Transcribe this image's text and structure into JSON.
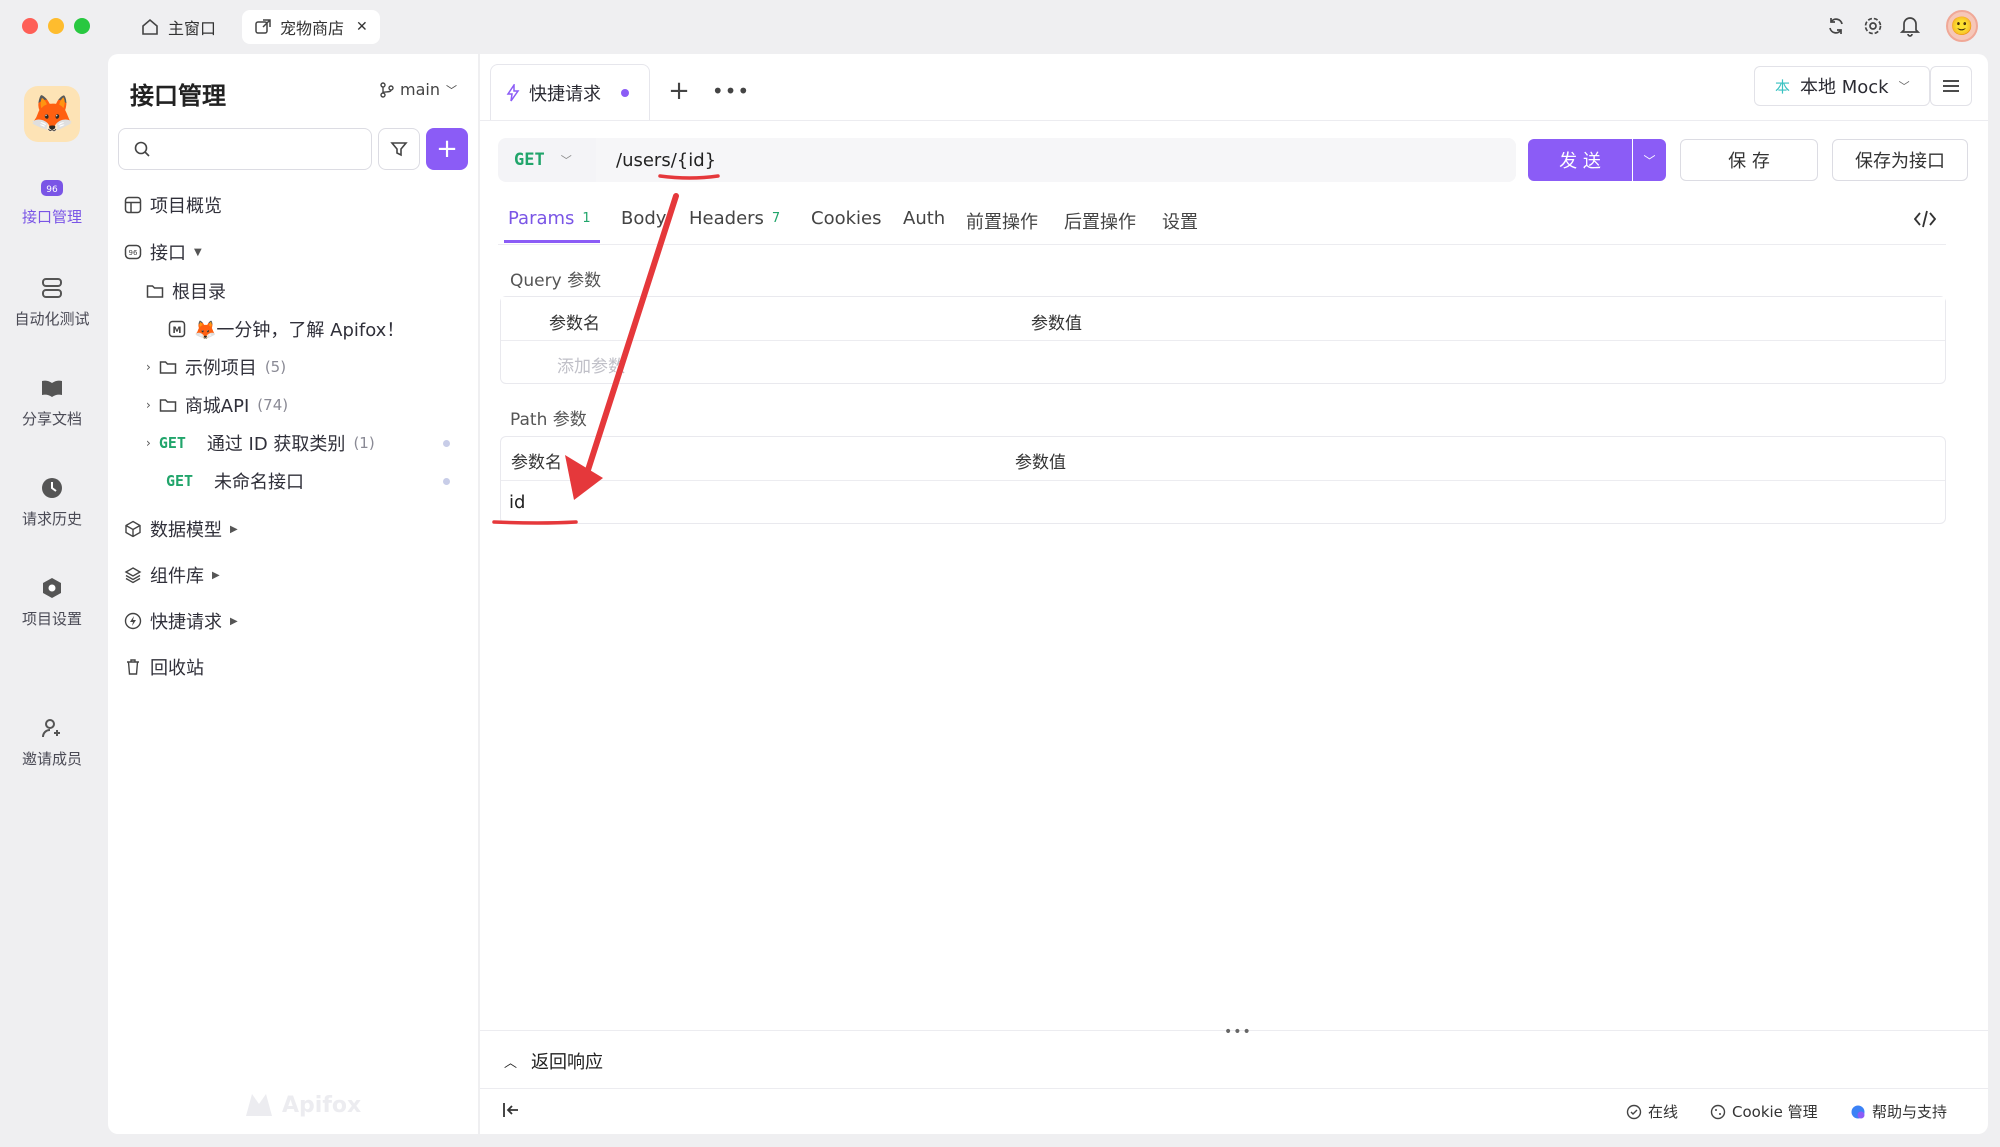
{
  "titlebar": {
    "home_tab": "主窗口",
    "project_tab": "宠物商店",
    "close": "✕"
  },
  "nav": {
    "items": [
      {
        "label": "接口管理"
      },
      {
        "label": "自动化测试"
      },
      {
        "label": "分享文档"
      },
      {
        "label": "请求历史"
      },
      {
        "label": "项目设置"
      },
      {
        "label": "邀请成员"
      }
    ]
  },
  "sidebar": {
    "title": "接口管理",
    "branch": "main",
    "search_placeholder": "",
    "overview": "项目概览",
    "api": "接口",
    "root": "根目录",
    "intro": "🦊一分钟，了解 Apifox！",
    "folder1": "示例项目",
    "folder1_count": "(5)",
    "folder2": "商城API",
    "folder2_count": "(74)",
    "get1_method": "GET",
    "get1_name": "通过 ID 获取类别",
    "get1_count": "(1)",
    "get2_method": "GET",
    "get2_name": "未命名接口",
    "models": "数据模型",
    "components": "组件库",
    "quick": "快捷请求",
    "trash": "回收站",
    "watermark": "Apifox"
  },
  "request": {
    "tab_label": "快捷请求",
    "env_icon": "本",
    "env": "本地 Mock",
    "method": "GET",
    "url": "/users/{id}",
    "send": "发 送",
    "save": "保 存",
    "save_as": "保存为接口"
  },
  "params_tabs": {
    "params": "Params",
    "params_count": "1",
    "body": "Body",
    "headers": "Headers",
    "headers_count": "7",
    "cookies": "Cookies",
    "auth": "Auth",
    "pre": "前置操作",
    "post": "后置操作",
    "settings": "设置"
  },
  "query": {
    "title": "Query 参数",
    "col_name": "参数名",
    "col_value": "参数值",
    "add_placeholder": "添加参数"
  },
  "path": {
    "title": "Path 参数",
    "col_name": "参数名",
    "col_value": "参数值",
    "row_name": "id"
  },
  "response": {
    "label": "返回响应"
  },
  "footer": {
    "online": "在线",
    "cookie": "Cookie 管理",
    "help": "帮助与支持"
  },
  "colors": {
    "accent": "#8b5cf6",
    "get": "#21a56b",
    "annotation": "#e5383b"
  }
}
